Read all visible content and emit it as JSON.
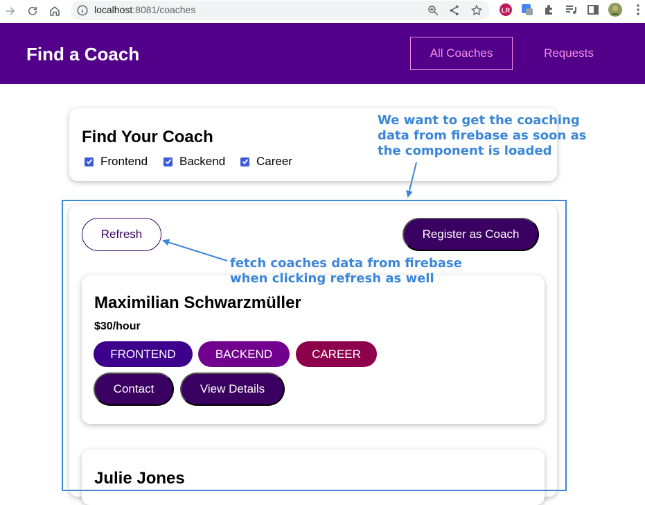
{
  "browser": {
    "url_host": "localhost",
    "url_path": ":8081/coaches"
  },
  "header": {
    "title": "Find a Coach",
    "nav": [
      {
        "label": "All Coaches",
        "active": true
      },
      {
        "label": "Requests",
        "active": false
      }
    ]
  },
  "filter": {
    "title": "Find Your Coach",
    "options": [
      {
        "label": "Frontend",
        "checked": true
      },
      {
        "label": "Backend",
        "checked": true
      },
      {
        "label": "Career",
        "checked": true
      }
    ]
  },
  "controls": {
    "refresh_label": "Refresh",
    "register_label": "Register as Coach"
  },
  "coaches": [
    {
      "name": "Maximilian Schwarzmüller",
      "rate": "$30/hour",
      "areas": [
        "FRONTEND",
        "BACKEND",
        "CAREER"
      ],
      "contact_label": "Contact",
      "details_label": "View Details"
    },
    {
      "name": "Julie Jones"
    }
  ],
  "annotations": {
    "top": "We want to get the coaching data from firebase as soon as the component is loaded",
    "bottom": "fetch coaches data from firebase when clicking refresh as well"
  },
  "colors": {
    "header_bg": "#52008a",
    "nav_link": "#f391e3",
    "primary": "#3a0061",
    "frontend": "#3d008d",
    "backend": "#71008f",
    "career": "#8d004b",
    "annotation": "#3b86d8"
  }
}
